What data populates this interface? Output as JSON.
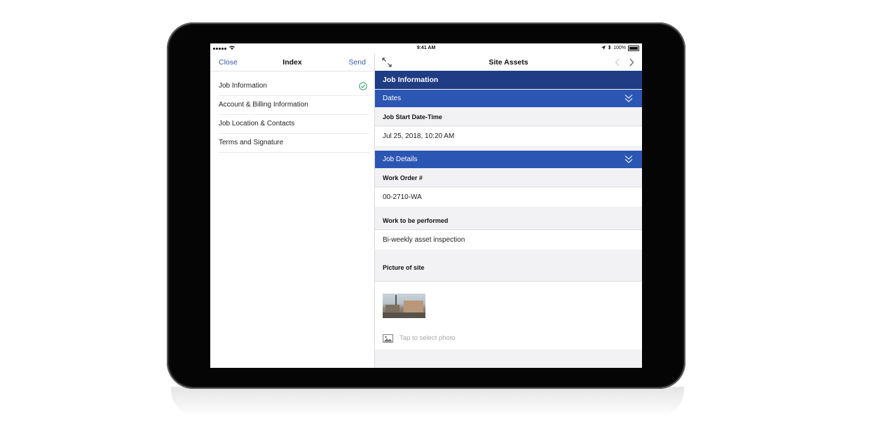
{
  "status_bar": {
    "time": "9:41 AM",
    "battery": "100%"
  },
  "left_panel": {
    "close_label": "Close",
    "title": "Index",
    "send_label": "Send",
    "items": [
      {
        "label": "Job Information",
        "completed": true
      },
      {
        "label": "Account & Billing Information",
        "completed": false
      },
      {
        "label": "Job Location & Contacts",
        "completed": false
      },
      {
        "label": "Terms and Signature",
        "completed": false
      }
    ]
  },
  "right_panel": {
    "title": "Site Assets",
    "section_title": "Job Information",
    "dates": {
      "header": "Dates",
      "start_label": "Job Start Date-Time",
      "start_value": "Jul 25, 2018, 10:20 AM"
    },
    "job_details": {
      "header": "Job Details",
      "work_order_label": "Work Order #",
      "work_order_value": "00-2710-WA",
      "work_label": "Work to be performed",
      "work_value": "Bi-weekly asset inspection",
      "picture_label": "Picture of site",
      "photo_hint": "Tap to select photo"
    }
  },
  "colors": {
    "section_header": "#1f3c84",
    "sub_header": "#2c56b3",
    "link": "#3b5aa8",
    "check": "#2e9e6a"
  },
  "icons": {
    "check": "check-circle-icon",
    "expand": "expand-arrows-icon",
    "prev": "chevron-left-icon",
    "next": "chevron-right-icon",
    "collapse": "double-chevron-down-icon",
    "photo": "image-icon"
  }
}
